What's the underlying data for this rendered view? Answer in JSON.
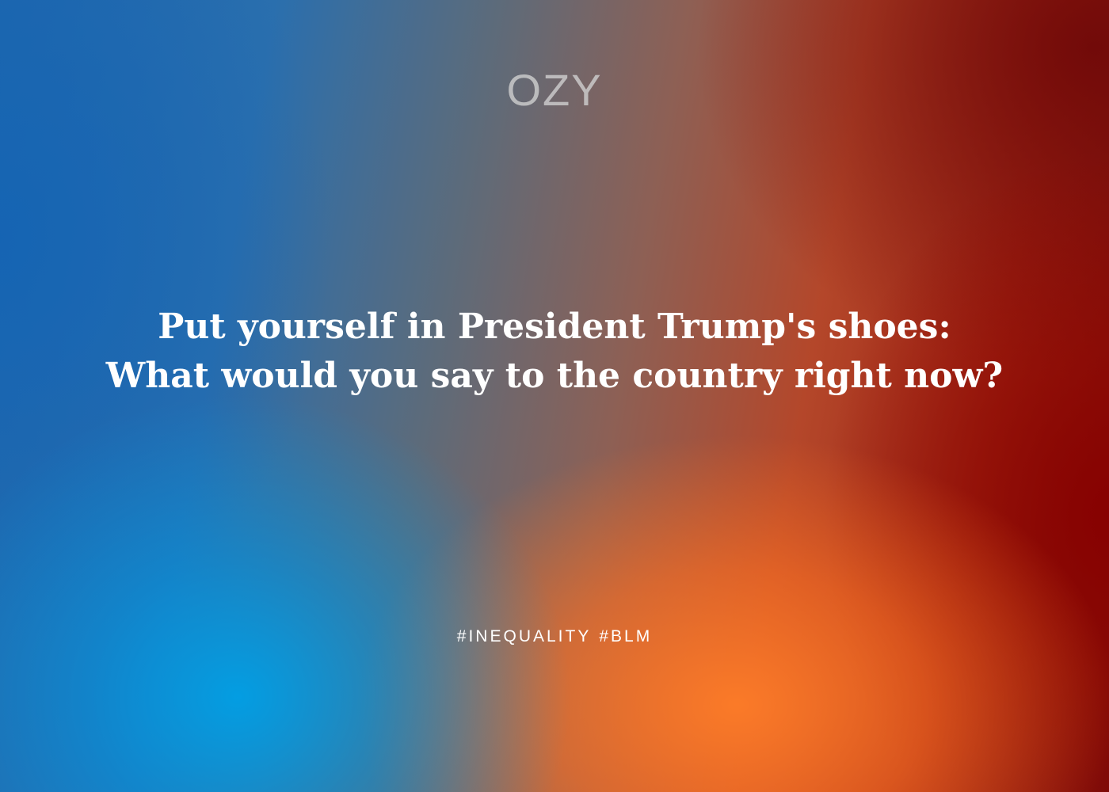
{
  "brand": {
    "logo_text": "OZY"
  },
  "headline": {
    "line1": "Put yourself in President Trump's shoes:",
    "line2": "What would you say to the country right now?"
  },
  "tags": [
    "#INEQUALITY",
    "#BLM"
  ]
}
